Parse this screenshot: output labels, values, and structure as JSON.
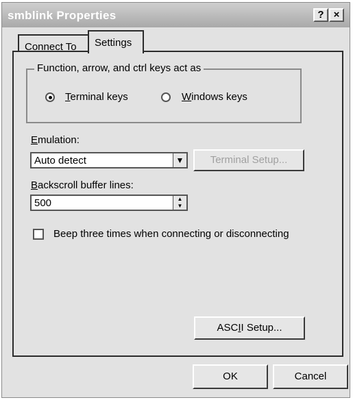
{
  "window": {
    "title": "smblink Properties",
    "help_button": "?",
    "close_button": "×"
  },
  "tabs": [
    {
      "label": "Connect To"
    },
    {
      "label": "Settings"
    }
  ],
  "keys_group": {
    "legend": "Function, arrow, and ctrl keys act as",
    "terminal_prefix": "",
    "terminal_mnemonic": "T",
    "terminal_rest": "erminal keys",
    "terminal_selected": true,
    "windows_prefix": "",
    "windows_mnemonic": "W",
    "windows_rest": "indows keys",
    "windows_selected": false
  },
  "emulation": {
    "label_mnemonic": "E",
    "label_rest": "mulation:",
    "value": "Auto detect",
    "setup_button": "Terminal Setup..."
  },
  "backscroll": {
    "label_mnemonic": "B",
    "label_rest": "ackscroll buffer lines:",
    "value": "500"
  },
  "beep": {
    "label": "Beep three times when connecting or disconnecting",
    "checked": false
  },
  "ascii_button": {
    "prefix": "ASC",
    "mnemonic": "I",
    "suffix": "I Setup..."
  },
  "footer": {
    "ok": "OK",
    "cancel": "Cancel"
  }
}
